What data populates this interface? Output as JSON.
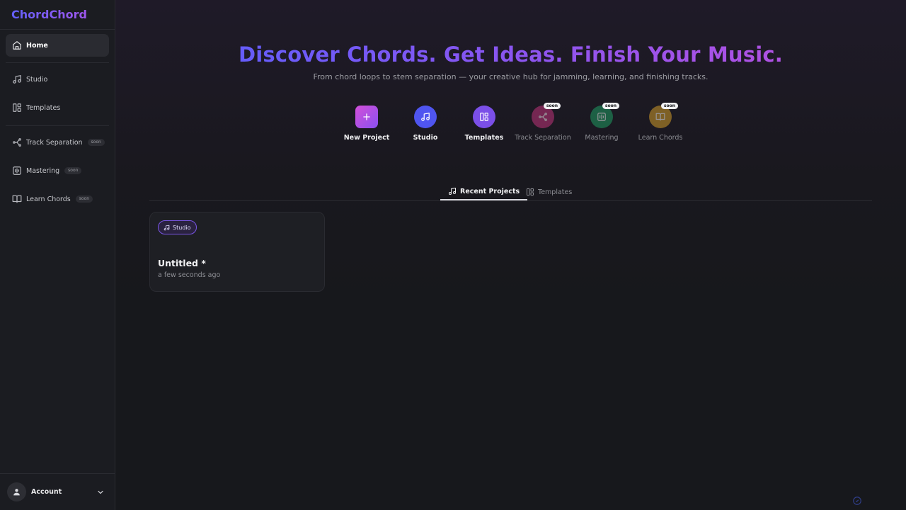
{
  "app": {
    "logo": "ChordChord"
  },
  "sidebar": {
    "items": [
      {
        "label": "Home",
        "icon": "home-icon"
      },
      {
        "label": "Studio",
        "icon": "music-note-icon"
      },
      {
        "label": "Templates",
        "icon": "templates-icon"
      },
      {
        "label": "Track Separation",
        "icon": "share-icon",
        "badge": "soon"
      },
      {
        "label": "Mastering",
        "icon": "waveform-icon",
        "badge": "soon"
      },
      {
        "label": "Learn Chords",
        "icon": "book-icon",
        "badge": "soon"
      }
    ],
    "account_label": "Account"
  },
  "hero": {
    "title": "Discover Chords. Get Ideas. Finish Your Music.",
    "subtitle": "From chord loops to stem separation — your creative hub for jamming, learning, and finishing tracks."
  },
  "quick_actions": [
    {
      "label": "New Project",
      "icon": "plus-icon",
      "color": "#b04fe0"
    },
    {
      "label": "Studio",
      "icon": "music-note-icon",
      "color": "#4f55f0"
    },
    {
      "label": "Templates",
      "icon": "templates-icon",
      "color": "#7b4fe8"
    },
    {
      "label": "Track Separation",
      "icon": "share-icon",
      "color": "#c0347a",
      "badge": "soon"
    },
    {
      "label": "Mastering",
      "icon": "waveform-icon",
      "color": "#1f9a62",
      "badge": "soon"
    },
    {
      "label": "Learn Chords",
      "icon": "book-icon",
      "color": "#d09a2a",
      "badge": "soon"
    }
  ],
  "tabs": [
    {
      "label": "Recent Projects",
      "active": true
    },
    {
      "label": "Templates",
      "active": false
    }
  ],
  "projects": [
    {
      "badge": "Studio",
      "title": "Untitled *",
      "time": "a few seconds ago"
    }
  ],
  "colors": {
    "accent_start": "#5560ff",
    "accent_end": "#c050dc",
    "background": "#17181c",
    "sidebar": "#1b1c21"
  }
}
